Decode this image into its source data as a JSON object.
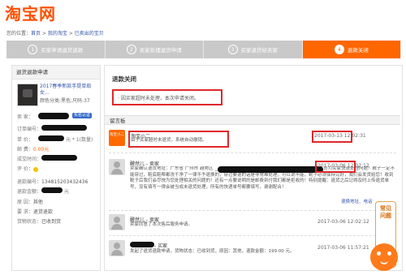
{
  "logo": "淘宝网",
  "breadcrumb": {
    "prefix": "您的位置：",
    "home": "首页",
    "sep1": " > ",
    "mytb": "我的淘宝",
    "sep2": " > ",
    "current": "已卖出的宝贝"
  },
  "steps": [
    {
      "num": "1",
      "label": "买家申请退货退款",
      "active": false
    },
    {
      "num": "2",
      "label": "卖家处理退货申请",
      "active": false
    },
    {
      "num": "3",
      "label": "买家退货给卖家",
      "active": false
    },
    {
      "num": "4",
      "label": "退款关闭",
      "active": true
    }
  ],
  "left_panel": {
    "header": "退货退款申请",
    "product_title": "2017春季新款手提单肩女...",
    "product_attr": "颜色分类:黑色;尺码:37",
    "seller_label": "卖   家：",
    "seller_badge": "实名认证",
    "order_no_label": "订单编号：",
    "unit_price_label": "单   价：",
    "unit_price_value": "元 * 1(数量)",
    "shipping_label": "邮   费：",
    "shipping_value": "0.00元",
    "deal_time_label": "成交时间：",
    "feedback_label": "评   价：",
    "refund_no_label": "退款编号：",
    "refund_no_value": "134815203432436",
    "refund_amount_label": "退款金额：",
    "refund_amount_unit": "元",
    "reason_label": "原   因：",
    "reason_value": "其他",
    "request_label": "要   求：",
    "request_value": "退货退款",
    "goods_status_label": "货物状态：",
    "goods_status_value": "已收到货"
  },
  "right_panel": {
    "title": "退款关闭",
    "reason_text": "· 因买家超时未处理，本次申请关闭。",
    "message_board": "留言板",
    "messages": [
      {
        "avatar_text": "淘宝小二",
        "name": "淘宝小二",
        "text": "由于买家超时未退货，系统自动撤销。",
        "time": "2017-03-13  12:02:31"
      },
      {
        "name": "醒然儿 - 卖家",
        "text": "卖家确认退货地址：广东省 广州市 越秀区 ________ 邮）已修改退货地址，这样方便我们的工作人员为买家快速处理问题！靴子一定不能穿过，鞋底鞋帮都洗干净了一律不予退换的，穿过要退的话是非常难处理，可以说不能，靴子必须保持完好，我们会发货给您！收到靴子后我们会尽快为您处理相关的问题的！还有一点要说明的是邮费到付我们都是拒收的！特别提醒：退货之后记得及时上传退货单号，没有填写一律会被当成未退货处理，所有的快递单号都要填写，谢谢配合！",
        "contact": "退换地址、电话",
        "time": "2017-03-06  12:02:12"
      },
      {
        "name": "醒然儿 - 卖家",
        "text": "卖家同意了本次售后服务申请。",
        "time": "2017-03-06  12:02:12"
      },
      {
        "name": " - 买家",
        "text": "发起了退货退款申请，货物状态：已收到货，原因：其他，退款金额：199.00 元。",
        "time": "2017-03-06  11:57:21"
      }
    ]
  },
  "help": {
    "text": "常见问题"
  }
}
